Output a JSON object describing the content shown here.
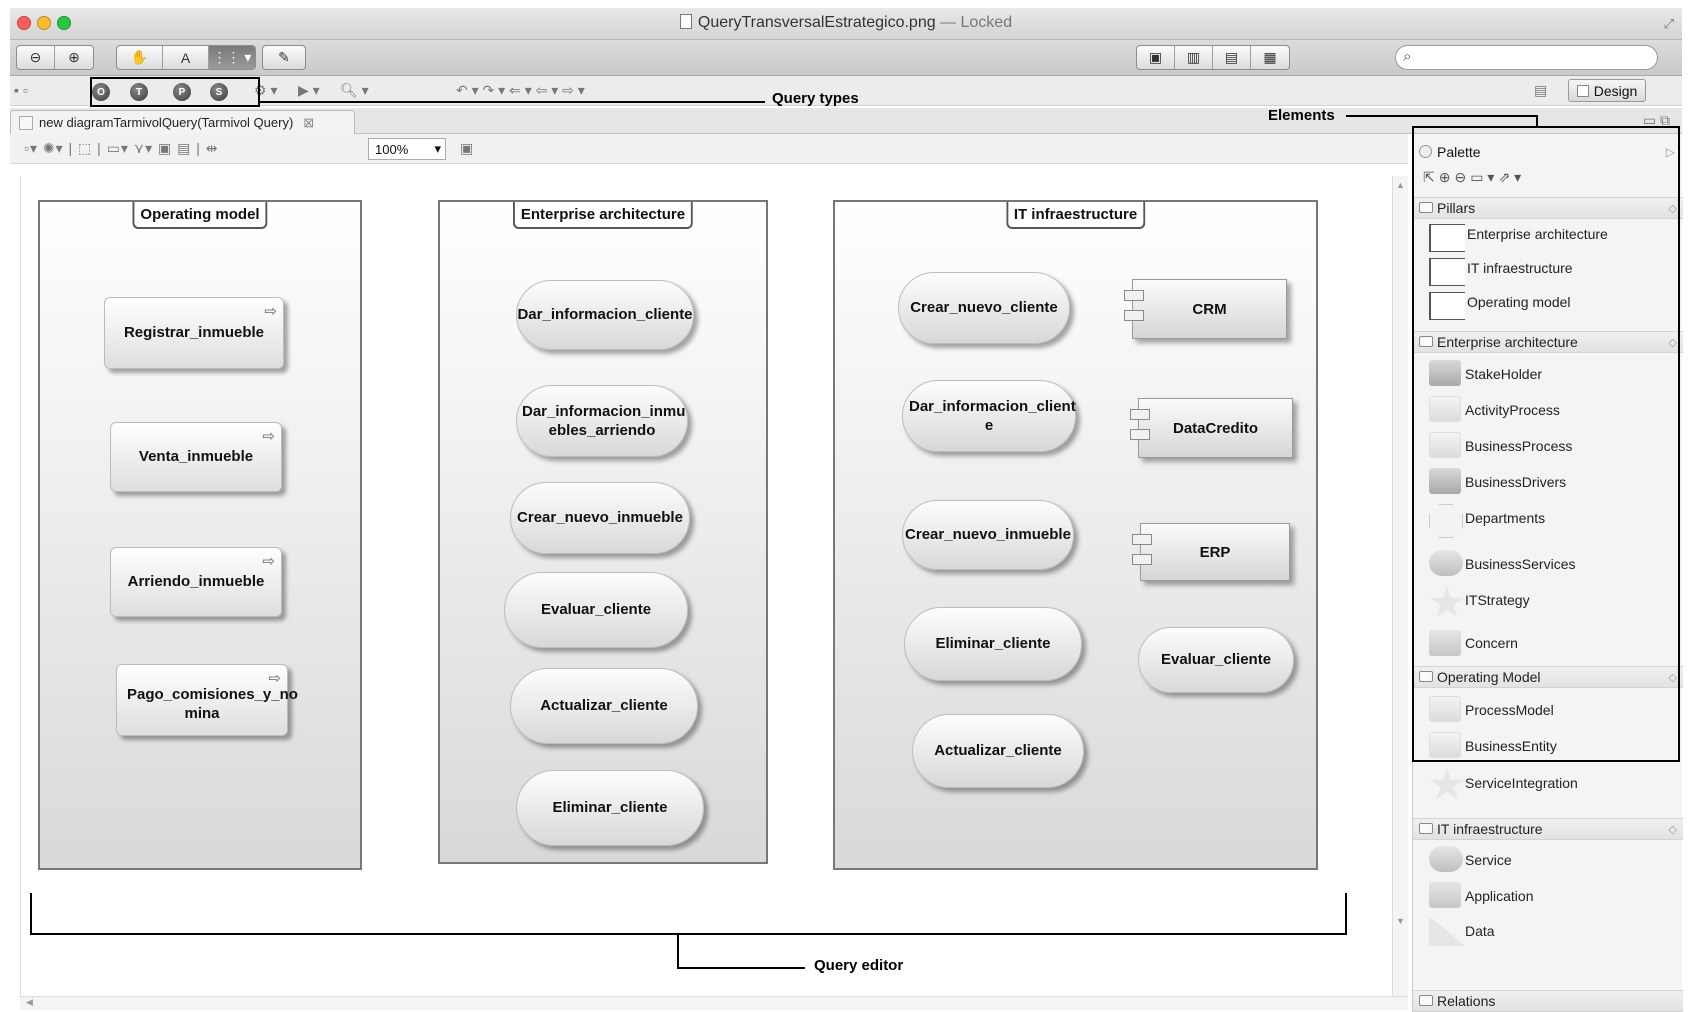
{
  "window": {
    "title": "QueryTransversalEstrategico.png",
    "title_suffix": "— Locked",
    "fullscreen_glyph": "⤢"
  },
  "preview_toolbar": {
    "zoom_out_glyph": "⊖",
    "zoom_in_glyph": "⊕",
    "hand_glyph": "✋",
    "text_glyph": "A",
    "select_glyph": "⋮⋮ ▾",
    "annotate_glyph": "✎",
    "search_placeholder": "",
    "view_glyphs": [
      "▣",
      "▥",
      "▤",
      "▦"
    ]
  },
  "eclipse_toolbar": {
    "query_type_glyphs": [
      "O",
      "T",
      "P",
      "S"
    ],
    "design_label": "Design",
    "run_glyph": "⚙ ▾",
    "play_glyph": "▶ ▾",
    "search_glyph": "🔍︎ ▾",
    "nav_glyphs": "↶ ▾  ↷ ▾  ⇐ ▾  ⇦ ▾  ⇨ ▾"
  },
  "tab": {
    "label": "new diagramTarmivolQuery(Tarmivol Query)",
    "close_glyph": "⊠"
  },
  "diagram_toolbar": {
    "zoom_value": "100%",
    "zoom_arrow": "▾",
    "glyphs": "▫▾  ✺▾  |  ⬚  |  ▭▾  ⋎▾  ▣  ▤  |  ⇹  "
  },
  "canvas": {
    "pillars": [
      {
        "title": "Operating model"
      },
      {
        "title": "Enterprise architecture"
      },
      {
        "title": "IT infraestructure"
      }
    ],
    "operating_model": [
      "Registrar_inmueble",
      "Venta_inmueble",
      "Arriendo_inmueble",
      "Pago_comisiones_y_no mina"
    ],
    "enterprise_architecture": [
      "Dar_informacion_cliente",
      "Dar_informacion_inmu ebles_arriendo",
      "Crear_nuevo_inmueble",
      "Evaluar_cliente",
      "Actualizar_cliente",
      "Eliminar_cliente"
    ],
    "it_services": [
      "Crear_nuevo_cliente",
      "Dar_informacion_client e",
      "Crear_nuevo_inmueble",
      "Eliminar_cliente",
      "Actualizar_cliente"
    ],
    "it_components": [
      "CRM",
      "DataCredito",
      "ERP"
    ],
    "it_extra": "Evaluar_cliente",
    "process_arrow": "⇨"
  },
  "palette": {
    "title": "Palette",
    "collapse_glyph": "▷",
    "tools": "⇱⊕⊖▭▾⇗▾",
    "sections": [
      {
        "label": "Pillars",
        "items": [
          "Enterprise architecture",
          "IT infraestructure",
          "Operating model"
        ]
      },
      {
        "label": "Enterprise architecture",
        "items": [
          "StakeHolder",
          "ActivityProcess",
          "BusinessProcess",
          "BusinessDrivers",
          "Departments",
          "BusinessServices",
          "ITStrategy",
          "Concern"
        ]
      },
      {
        "label": "Operating Model",
        "items": [
          "ProcessModel",
          "BusinessEntity",
          "ServiceIntegration"
        ]
      },
      {
        "label": "IT infraestructure",
        "items": [
          "Service",
          "Application",
          "Data"
        ]
      },
      {
        "label": "Relations",
        "items": []
      }
    ],
    "section_chevron": "◇"
  },
  "annotations": {
    "query_types": "Query types",
    "elements": "Elements",
    "query_editor": "Query editor"
  }
}
